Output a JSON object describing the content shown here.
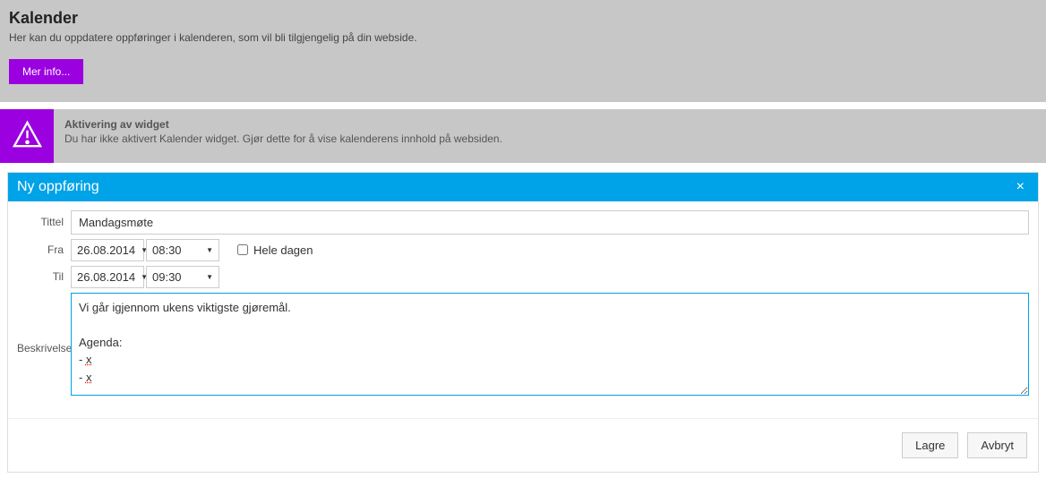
{
  "top": {
    "heading": "Kalender",
    "description": "Her kan du oppdatere oppføringer i kalenderen, som vil bli tilgjengelig på din webside.",
    "more_button": "Mer info..."
  },
  "alert": {
    "title": "Aktivering av widget",
    "desc": "Du har ikke aktivert Kalender widget. Gjør dette for å vise kalenderens innhold på websiden."
  },
  "dialog": {
    "title": "Ny oppføring",
    "close": "×",
    "labels": {
      "title": "Tittel",
      "from": "Fra",
      "to": "Til",
      "desc": "Beskrivelse",
      "allday": "Hele dagen"
    },
    "fields": {
      "title_value": "Mandagsmøte",
      "from_date": "26.08.2014",
      "from_time": "08:30",
      "to_date": "26.08.2014",
      "to_time": "09:30",
      "allday_checked": false,
      "desc_line1": "Vi går igjennom ukens viktigste gjøremål.",
      "desc_line2": "Agenda:",
      "desc_line3_prefix": "- ",
      "desc_line3_err": "x",
      "desc_line4_prefix": "- ",
      "desc_line4_err": "x"
    },
    "buttons": {
      "save": "Lagre",
      "cancel": "Avbryt"
    }
  }
}
